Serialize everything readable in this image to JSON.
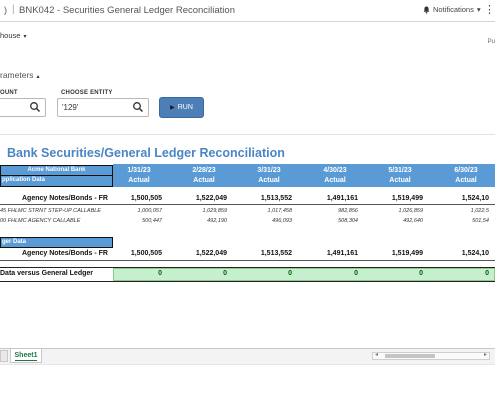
{
  "app": {
    "back_glyph": ")",
    "separator": "|",
    "title": "BNK042 - Securities General Ledger Reconciliation",
    "notifications_label": "Notifications",
    "notifications_caret": "▾",
    "more_glyph": "⋮"
  },
  "warehouse": {
    "label": "house",
    "caret": "▾"
  },
  "right_stub": "Pu",
  "params": {
    "label": "rameters",
    "caret": "▴",
    "account_label": "OUNT",
    "entity_label": "CHOOSE ENTITY",
    "entity_value": "'129'",
    "run_label": "RUN",
    "run_glyph": "▶"
  },
  "report": {
    "title": "Bank Securities/General Ledger Reconciliation",
    "company": "Acme National Bank",
    "app_data_label": "pplication Data",
    "ledger_data_label": "ger Data",
    "section_row_label": "Agency Notes/Bonds - FR",
    "sub1_label": "45 FHLMC STRNT STEP-UP CALLABLE",
    "sub2_label": "00 FHLMC AGENCY CALLABLE",
    "variance_label": "Data versus General Ledger",
    "columns": [
      {
        "date": "1/31/23",
        "kind": "Actual"
      },
      {
        "date": "2/28/23",
        "kind": "Actual"
      },
      {
        "date": "3/31/23",
        "kind": "Actual"
      },
      {
        "date": "4/30/23",
        "kind": "Actual"
      },
      {
        "date": "5/31/23",
        "kind": "Actual"
      },
      {
        "date": "6/30/23",
        "kind": "Actual"
      }
    ],
    "app_totals": [
      "1,500,505",
      "1,522,049",
      "1,513,552",
      "1,491,161",
      "1,519,499",
      "1,524,10"
    ],
    "sub1_values": [
      "1,000,057",
      "1,029,859",
      "1,017,458",
      "982,856",
      "1,026,859",
      "1,022,5"
    ],
    "sub2_values": [
      "500,447",
      "492,190",
      "496,093",
      "508,304",
      "492,640",
      "501,54"
    ],
    "gl_totals": [
      "1,500,505",
      "1,522,049",
      "1,513,552",
      "1,491,161",
      "1,519,499",
      "1,524,10"
    ],
    "variance": [
      "0",
      "0",
      "0",
      "0",
      "0",
      "0"
    ]
  },
  "sheet_tab": "Sheet1",
  "colors": {
    "accent": "#5b9bd5",
    "title": "#4a86c5",
    "variance_fill": "#c6efce",
    "run_button": "#4b7fb5"
  }
}
